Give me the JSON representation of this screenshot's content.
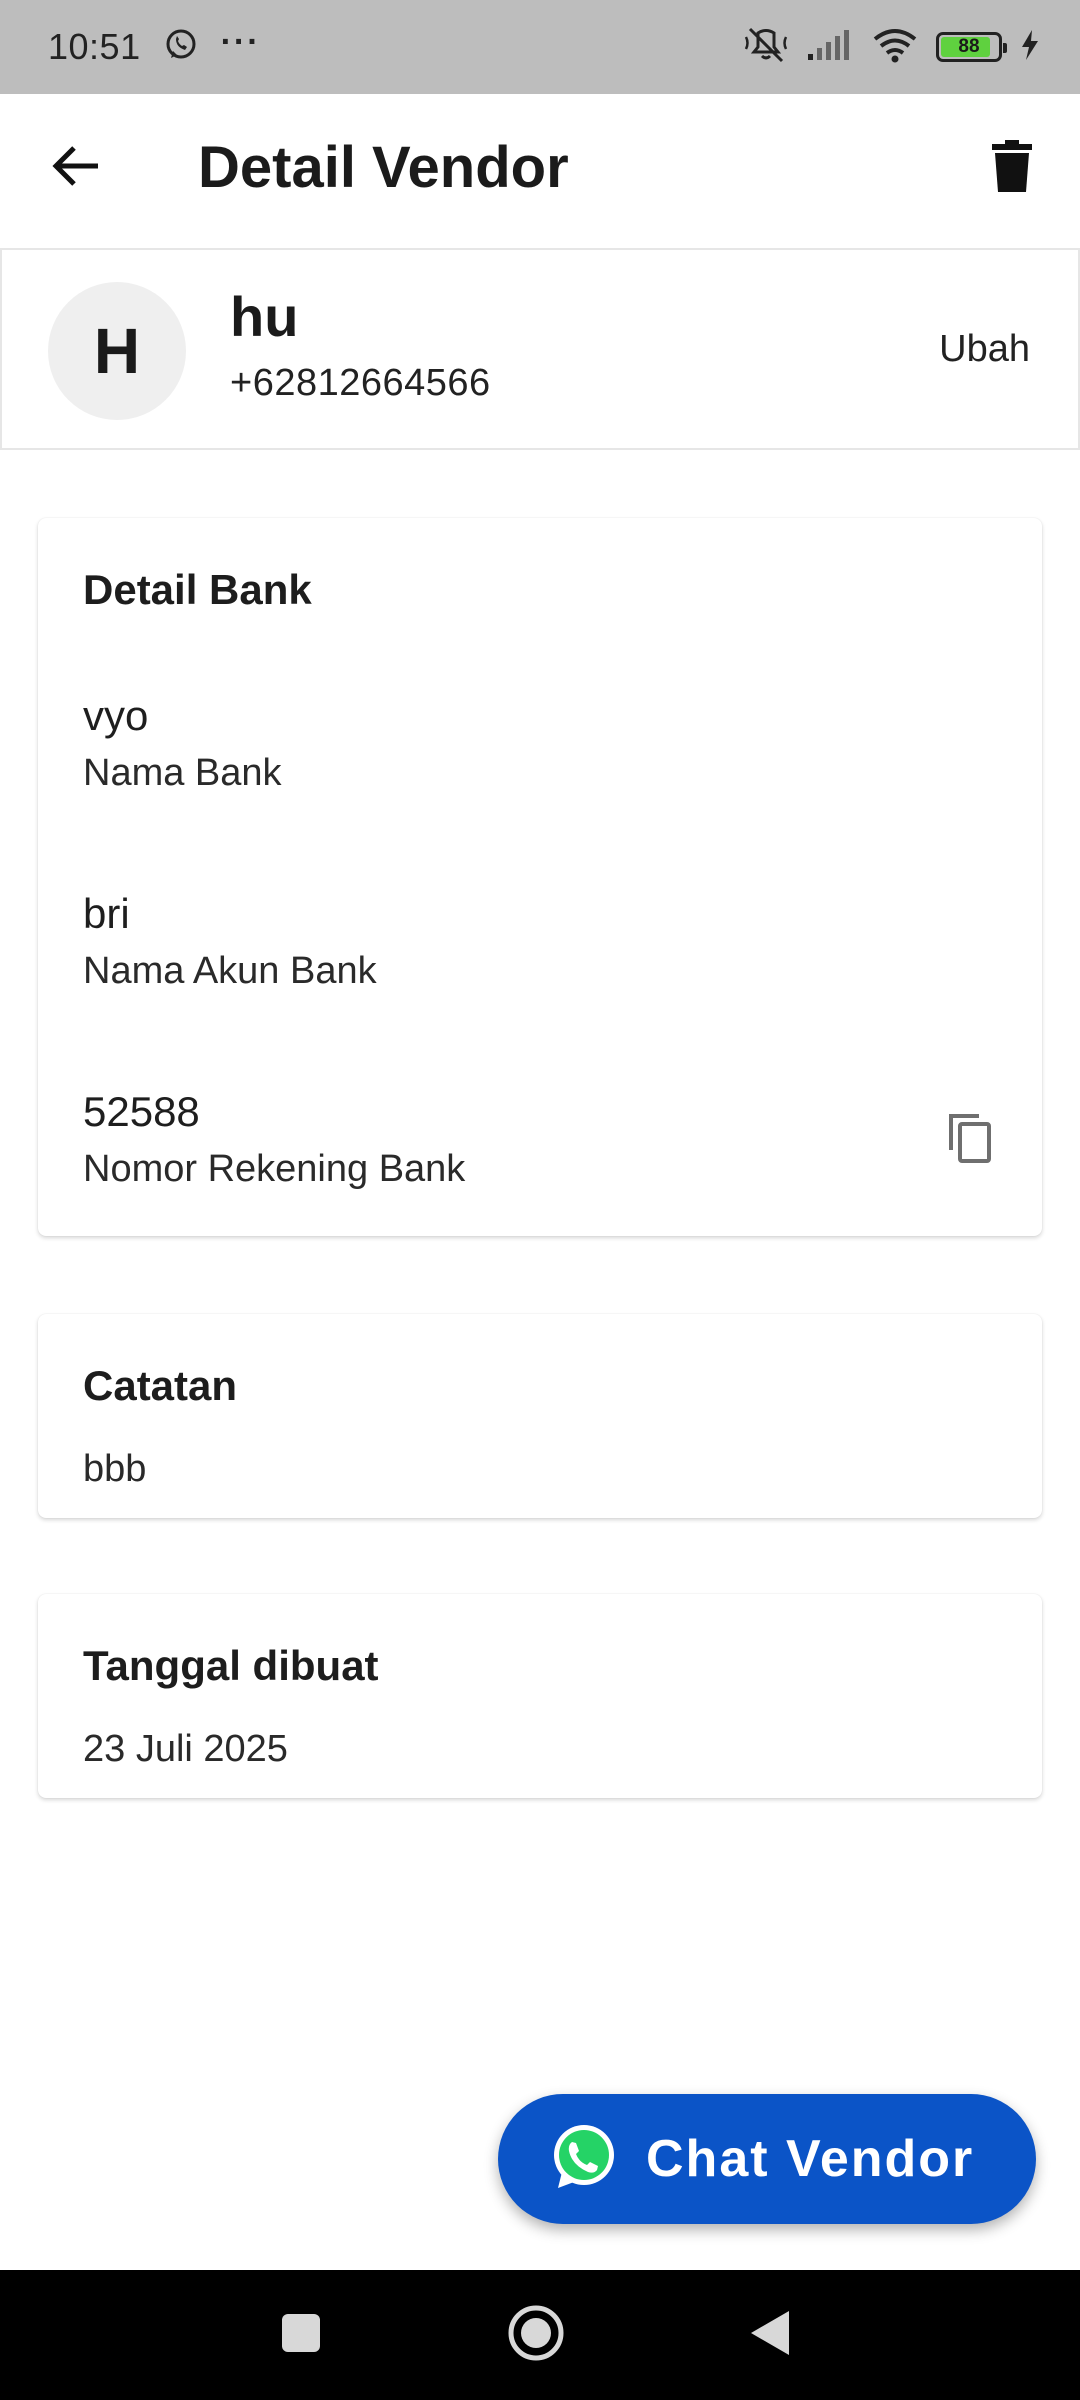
{
  "status_bar": {
    "time": "10:51",
    "more": "···",
    "battery_level": "88",
    "battery_fraction": 0.88,
    "icons": [
      "whatsapp-notification-icon",
      "mute-icon",
      "signal-icon",
      "wifi-icon",
      "battery-icon",
      "charging-icon"
    ]
  },
  "app_bar": {
    "title": "Detail Vendor",
    "back_icon": "arrow-back-icon",
    "delete_icon": "trash-icon"
  },
  "vendor": {
    "initial": "H",
    "name": "hu",
    "phone": "+62812664566",
    "edit_label": "Ubah"
  },
  "bank_card": {
    "title": "Detail Bank",
    "fields": [
      {
        "value": "vyo",
        "label": "Nama Bank"
      },
      {
        "value": "bri",
        "label": "Nama Akun Bank"
      },
      {
        "value": "52588",
        "label": "Nomor Rekening Bank"
      }
    ],
    "copy_icon": "copy-icon"
  },
  "notes_card": {
    "title": "Catatan",
    "text": "bbb"
  },
  "created_card": {
    "title": "Tanggal dibuat",
    "text": "23 Juli 2025"
  },
  "fab": {
    "label": "Chat Vendor",
    "icon": "whatsapp-icon",
    "color": "#0b54c7"
  },
  "nav_bar": {
    "icons": [
      "recents-square-icon",
      "home-circle-icon",
      "back-triangle-icon"
    ]
  }
}
